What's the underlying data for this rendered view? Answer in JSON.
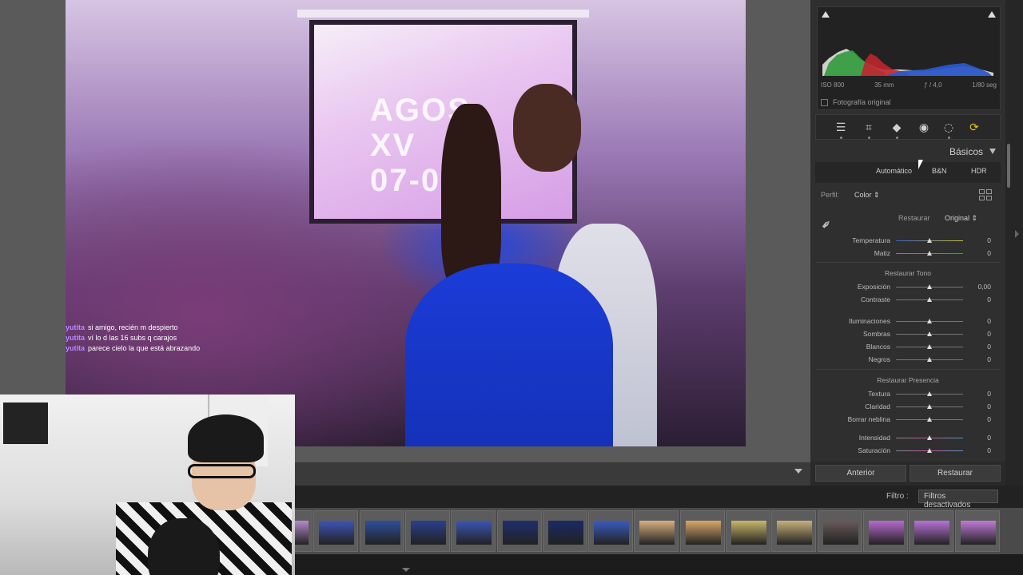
{
  "chat": [
    {
      "user": "yutita",
      "msg": "si amigo, recién m despierto"
    },
    {
      "user": "yutita",
      "msg": "ví lo d las 16 subs q carajos"
    },
    {
      "user": "yutita",
      "msg": "parece cielo la que está abrazando"
    }
  ],
  "photo": {
    "screen_text": "AGOS\nXV\n07-03"
  },
  "histogram": {
    "exif": {
      "iso": "ISO 800",
      "focal": "35 mm",
      "aperture": "ƒ / 4,0",
      "shutter": "1/80 seg"
    },
    "original_label": "Fotografía original"
  },
  "tools": [
    "sliders-icon",
    "crop-icon",
    "eraser-icon",
    "eye-icon",
    "mask-icon",
    "rotate-icon"
  ],
  "panel": {
    "section_title": "Básicos",
    "treatment": {
      "auto": "Automático",
      "bw": "B&N",
      "hdr": "HDR"
    },
    "profile": {
      "label": "Perfil:",
      "value": "Color",
      "arrows": "⇕"
    },
    "restore": {
      "label": "Restaurar",
      "value": "Original",
      "arrows": "⇕"
    },
    "groups": {
      "tone": "Restaurar Tono",
      "presence": "Restaurar Presencia"
    },
    "sliders": {
      "temp": {
        "label": "Temperatura",
        "value": "0",
        "pos": 0.5
      },
      "tint": {
        "label": "Matiz",
        "value": "0",
        "pos": 0.5
      },
      "exposure": {
        "label": "Exposición",
        "value": "0,00",
        "pos": 0.5
      },
      "contrast": {
        "label": "Contraste",
        "value": "0",
        "pos": 0.5
      },
      "highlights": {
        "label": "Iluminaciones",
        "value": "0",
        "pos": 0.5
      },
      "shadows": {
        "label": "Sombras",
        "value": "0",
        "pos": 0.5
      },
      "whites": {
        "label": "Blancos",
        "value": "0",
        "pos": 0.5
      },
      "blacks": {
        "label": "Negros",
        "value": "0",
        "pos": 0.5
      },
      "texture": {
        "label": "Textura",
        "value": "0",
        "pos": 0.5
      },
      "clarity": {
        "label": "Claridad",
        "value": "0",
        "pos": 0.5
      },
      "dehaze": {
        "label": "Borrar neblina",
        "value": "0",
        "pos": 0.5
      },
      "vibrance": {
        "label": "Intensidad",
        "value": "0",
        "pos": 0.5
      },
      "saturation": {
        "label": "Saturación",
        "value": "0",
        "pos": 0.5
      }
    },
    "buttons": {
      "previous": "Anterior",
      "reset": "Restaurar"
    }
  },
  "filmbar": {
    "filter_label": "Filtro :",
    "filter_value": "Filtros desactivados"
  },
  "colors": {
    "panel_bg": "#2f2f2f",
    "accent_blue": "#1b3cd8",
    "chat_user": "#b58bff"
  }
}
